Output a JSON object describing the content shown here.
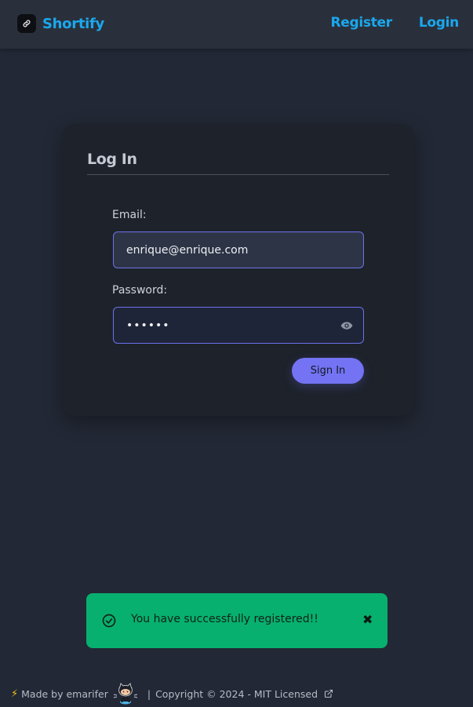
{
  "header": {
    "brand_name": "Shortify",
    "nav": {
      "register": "Register",
      "login": "Login"
    }
  },
  "form": {
    "title": "Log In",
    "email_label": "Email:",
    "email_value": "enrique@enrique.com",
    "password_label": "Password:",
    "password_value": "••••••",
    "submit_label": "Sign In"
  },
  "toast": {
    "message": "You have successfully registered!!",
    "close_symbol": "✖"
  },
  "footer": {
    "bolt": "⚡",
    "made_by": "Made by emarifer",
    "separator": "|",
    "copyright": "Copyright © 2024 - MIT Licensed"
  },
  "colors": {
    "accent": "#1aa8ee",
    "button": "#7373f3",
    "toast_bg": "#07b06e",
    "background": "#222835"
  },
  "icons": {
    "brand": "link-icon",
    "password_toggle": "eye-icon",
    "toast_status": "check-circle-icon",
    "toast_close": "close-icon",
    "github": "github-octocat-icon",
    "external_link": "external-link-icon"
  }
}
